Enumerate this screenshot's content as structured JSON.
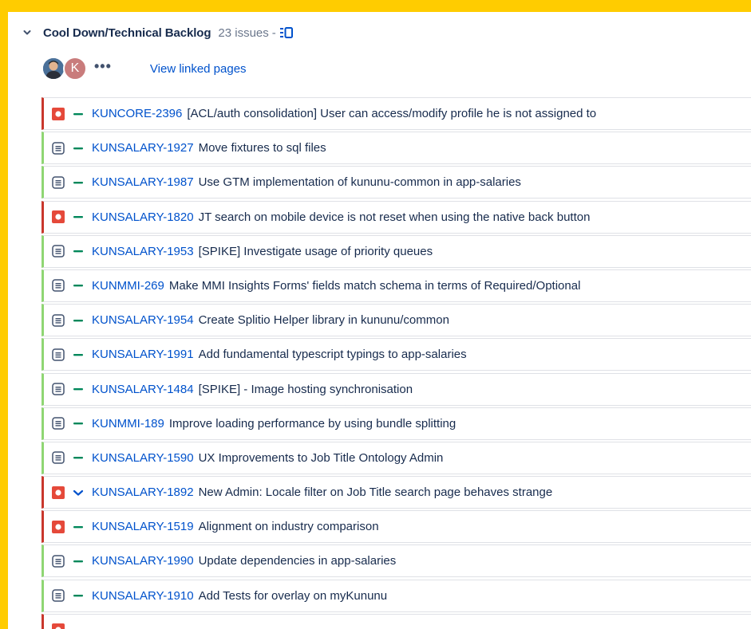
{
  "backlog": {
    "title": "Cool Down/Technical Backlog",
    "issue_count": "23 issues",
    "separator": "-",
    "view_linked_pages": "View linked pages",
    "avatar_initial": "K",
    "more_label": "•••"
  },
  "colors": {
    "page_background": "#FFCC00",
    "link_blue": "#0052CC",
    "bug_red": "#C9372C",
    "improvement_green": "#8FD673",
    "priority_green": "#00875A"
  },
  "issues": [
    {
      "key": "KUNCORE-2396",
      "summary": "[ACL/auth consolidation] User can access/modify profile he is not assigned to",
      "type": "bug",
      "type_icon": "bug-icon",
      "priority": "medium",
      "priority_icon": "priority-medium-icon"
    },
    {
      "key": "KUNSALARY-1927",
      "summary": "Move fixtures to sql files",
      "type": "task",
      "type_icon": "task-icon",
      "priority": "medium",
      "priority_icon": "priority-medium-icon"
    },
    {
      "key": "KUNSALARY-1987",
      "summary": "Use GTM implementation of kununu-common in app-salaries",
      "type": "task",
      "type_icon": "task-icon",
      "priority": "medium",
      "priority_icon": "priority-medium-icon"
    },
    {
      "key": "KUNSALARY-1820",
      "summary": "JT search on mobile device is not reset when using the native back button",
      "type": "bug",
      "type_icon": "bug-icon",
      "priority": "medium",
      "priority_icon": "priority-medium-icon"
    },
    {
      "key": "KUNSALARY-1953",
      "summary": "[SPIKE] Investigate usage of priority queues",
      "type": "task",
      "type_icon": "task-icon",
      "priority": "medium",
      "priority_icon": "priority-medium-icon"
    },
    {
      "key": "KUNMMI-269",
      "summary": "Make MMI Insights Forms' fields match schema in terms of Required/Optional",
      "type": "task",
      "type_icon": "task-icon",
      "priority": "medium",
      "priority_icon": "priority-medium-icon"
    },
    {
      "key": "KUNSALARY-1954",
      "summary": "Create Splitio Helper library in kununu/common",
      "type": "task",
      "type_icon": "task-icon",
      "priority": "medium",
      "priority_icon": "priority-medium-icon"
    },
    {
      "key": "KUNSALARY-1991",
      "summary": "Add fundamental typescript typings to app-salaries",
      "type": "task",
      "type_icon": "task-icon",
      "priority": "medium",
      "priority_icon": "priority-medium-icon"
    },
    {
      "key": "KUNSALARY-1484",
      "summary": "[SPIKE] - Image hosting synchronisation",
      "type": "task",
      "type_icon": "task-icon",
      "priority": "medium",
      "priority_icon": "priority-medium-icon"
    },
    {
      "key": "KUNMMI-189",
      "summary": "Improve loading performance by using bundle splitting",
      "type": "task",
      "type_icon": "task-icon",
      "priority": "medium",
      "priority_icon": "priority-medium-icon"
    },
    {
      "key": "KUNSALARY-1590",
      "summary": "UX Improvements to Job Title Ontology Admin",
      "type": "task",
      "type_icon": "task-icon",
      "priority": "medium",
      "priority_icon": "priority-medium-icon"
    },
    {
      "key": "KUNSALARY-1892",
      "summary": "New Admin: Locale filter on Job Title search page behaves strange",
      "type": "bug",
      "type_icon": "bug-icon",
      "priority": "low",
      "priority_icon": "priority-low-icon"
    },
    {
      "key": "KUNSALARY-1519",
      "summary": "Alignment on industry comparison",
      "type": "bug",
      "type_icon": "bug-icon",
      "priority": "medium",
      "priority_icon": "priority-medium-icon"
    },
    {
      "key": "KUNSALARY-1990",
      "summary": "Update dependencies in app-salaries",
      "type": "task",
      "type_icon": "task-icon",
      "priority": "medium",
      "priority_icon": "priority-medium-icon"
    },
    {
      "key": "KUNSALARY-1910",
      "summary": "Add Tests for overlay on myKununu",
      "type": "task",
      "type_icon": "task-icon",
      "priority": "medium",
      "priority_icon": "priority-medium-icon"
    },
    {
      "key": "",
      "summary": "",
      "type": "bug",
      "type_icon": "bug-icon",
      "priority": "medium",
      "priority_icon": "priority-medium-icon"
    }
  ]
}
